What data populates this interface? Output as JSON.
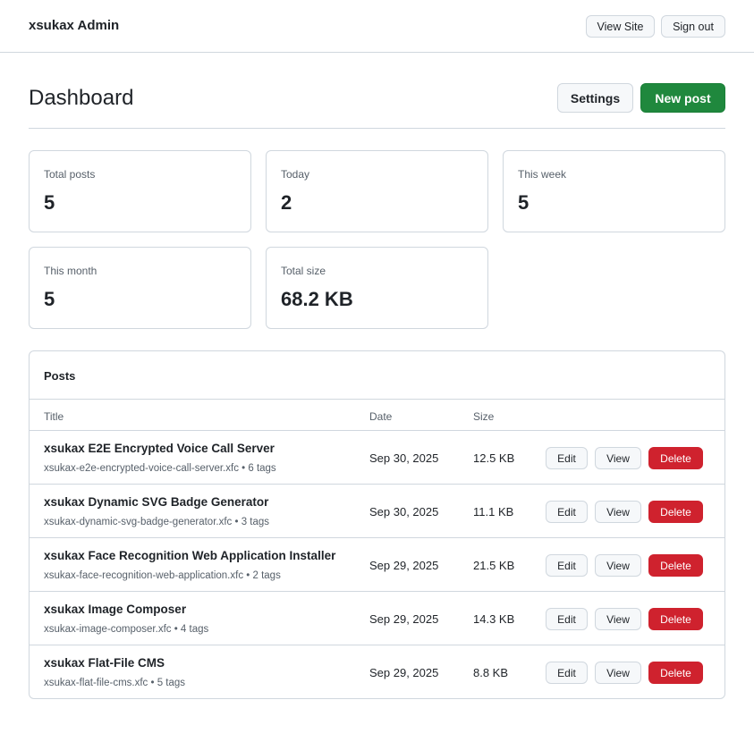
{
  "header": {
    "brand": "xsukax Admin",
    "view_site_label": "View Site",
    "sign_out_label": "Sign out"
  },
  "page": {
    "title": "Dashboard",
    "settings_label": "Settings",
    "new_post_label": "New post"
  },
  "stats": [
    {
      "label": "Total posts",
      "value": "5"
    },
    {
      "label": "Today",
      "value": "2"
    },
    {
      "label": "This week",
      "value": "5"
    },
    {
      "label": "This month",
      "value": "5"
    },
    {
      "label": "Total size",
      "value": "68.2 KB"
    }
  ],
  "posts": {
    "title": "Posts",
    "columns": {
      "title": "Title",
      "date": "Date",
      "size": "Size"
    },
    "actions": {
      "edit": "Edit",
      "view": "View",
      "delete": "Delete"
    },
    "rows": [
      {
        "title": "xsukax E2E Encrypted Voice Call Server",
        "meta": "xsukax-e2e-encrypted-voice-call-server.xfc • 6 tags",
        "date": "Sep 30, 2025",
        "size": "12.5 KB"
      },
      {
        "title": "xsukax Dynamic SVG Badge Generator",
        "meta": "xsukax-dynamic-svg-badge-generator.xfc • 3 tags",
        "date": "Sep 30, 2025",
        "size": "11.1 KB"
      },
      {
        "title": "xsukax Face Recognition Web Application Installer",
        "meta": "xsukax-face-recognition-web-application.xfc • 2 tags",
        "date": "Sep 29, 2025",
        "size": "21.5 KB"
      },
      {
        "title": "xsukax Image Composer",
        "meta": "xsukax-image-composer.xfc • 4 tags",
        "date": "Sep 29, 2025",
        "size": "14.3 KB"
      },
      {
        "title": "xsukax Flat-File CMS",
        "meta": "xsukax-flat-file-cms.xfc • 5 tags",
        "date": "Sep 29, 2025",
        "size": "8.8 KB"
      }
    ]
  }
}
